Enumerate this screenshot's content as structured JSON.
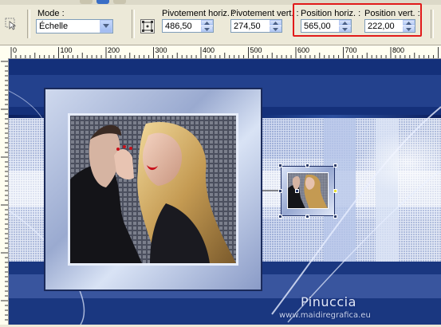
{
  "toolbar": {
    "mode_label": "Mode :",
    "mode_value": "Échelle",
    "pivot_h_label": "Pivotement horiz. :",
    "pivot_h_value": "486,50",
    "pivot_v_label": "Pivotement vert. :",
    "pivot_v_value": "274,50",
    "pos_h_label": "Position horiz. :",
    "pos_h_value": "565,00",
    "pos_v_label": "Position vert. :",
    "pos_v_value": "222,00"
  },
  "ruler": {
    "labels": [
      "0",
      "100",
      "200",
      "300",
      "400",
      "500",
      "600",
      "700",
      "800"
    ]
  },
  "canvas": {
    "watermark_name": "Pinuccia",
    "watermark_url": "www.maidiregrafica.eu"
  },
  "colors": {
    "highlight_box": "#e11a1a",
    "canvas_blue": "#1b3f8f"
  },
  "icons": [
    "pick-tool-icon",
    "center-node-icon",
    "dropdown-arrow-icon",
    "spin-up-icon",
    "spin-down-icon"
  ]
}
